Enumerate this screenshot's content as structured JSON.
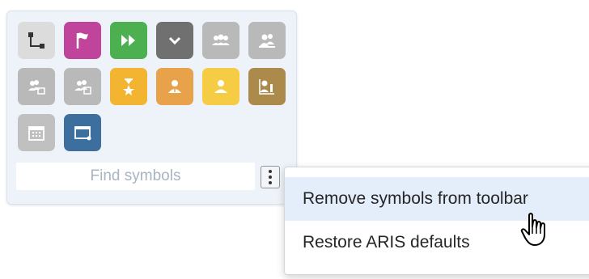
{
  "symbols": [
    {
      "icon": "connector-icon",
      "color": "#dcdcdc"
    },
    {
      "icon": "flag-icon",
      "color": "#c0449b"
    },
    {
      "icon": "fast-forward-icon",
      "color": "#4caf50"
    },
    {
      "icon": "chevron-down-icon",
      "color": "#707070"
    },
    {
      "icon": "group-icon",
      "color": "#b9b9b9"
    },
    {
      "icon": "organization-icon",
      "color": "#b9b9b9"
    },
    {
      "icon": "group-document-icon",
      "color": "#b9b9b9"
    },
    {
      "icon": "group-box-icon",
      "color": "#b9b9b9"
    },
    {
      "icon": "star-person-icon",
      "color": "#f2b431"
    },
    {
      "icon": "person-role-icon",
      "color": "#e8a24a"
    },
    {
      "icon": "person-icon",
      "color": "#f6cc45"
    },
    {
      "icon": "person-chart-icon",
      "color": "#ab8a4c"
    },
    {
      "icon": "calendar-icon",
      "color": "#c0c0c0"
    },
    {
      "icon": "window-icon",
      "color": "#3d6f9e"
    }
  ],
  "search": {
    "placeholder": "Find symbols"
  },
  "menu": {
    "items": [
      {
        "label": "Remove symbols from toolbar"
      },
      {
        "label": "Restore ARIS defaults"
      }
    ]
  }
}
